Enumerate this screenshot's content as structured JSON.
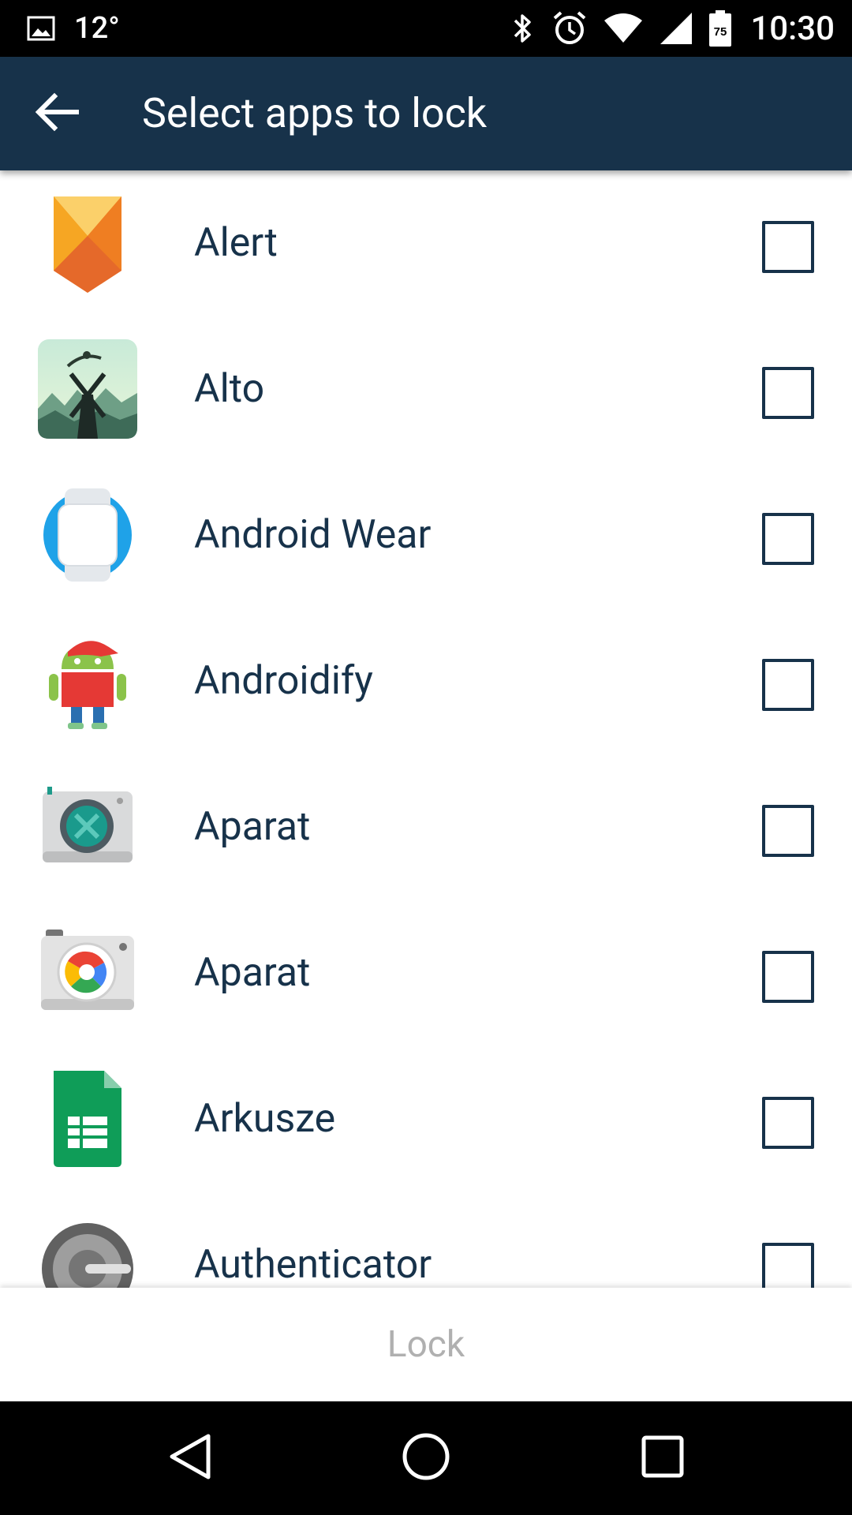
{
  "status_bar": {
    "temperature": "12°",
    "battery_level": "75",
    "time": "10:30",
    "icons": [
      "image-icon",
      "bluetooth-icon",
      "alarm-icon",
      "wifi-icon",
      "signal-icon",
      "battery-icon"
    ]
  },
  "app_bar": {
    "back_icon": "arrow-back-icon",
    "title": "Select apps to lock",
    "background_color": "#17324a"
  },
  "apps": [
    {
      "name": "Alert",
      "icon": "alert-app-icon",
      "checked": false
    },
    {
      "name": "Alto",
      "icon": "alto-app-icon",
      "checked": false
    },
    {
      "name": "Android Wear",
      "icon": "android-wear-app-icon",
      "checked": false
    },
    {
      "name": "Androidify",
      "icon": "androidify-app-icon",
      "checked": false
    },
    {
      "name": "Aparat",
      "icon": "camera-app-icon",
      "checked": false
    },
    {
      "name": "Aparat",
      "icon": "google-camera-app-icon",
      "checked": false
    },
    {
      "name": "Arkusze",
      "icon": "sheets-app-icon",
      "checked": false
    },
    {
      "name": "Authenticator",
      "icon": "authenticator-app-icon",
      "checked": false
    }
  ],
  "lock_button": {
    "label": "Lock",
    "enabled": false
  },
  "nav_bar": {
    "back": "nav-back-icon",
    "home": "nav-home-icon",
    "recents": "nav-recents-icon"
  }
}
